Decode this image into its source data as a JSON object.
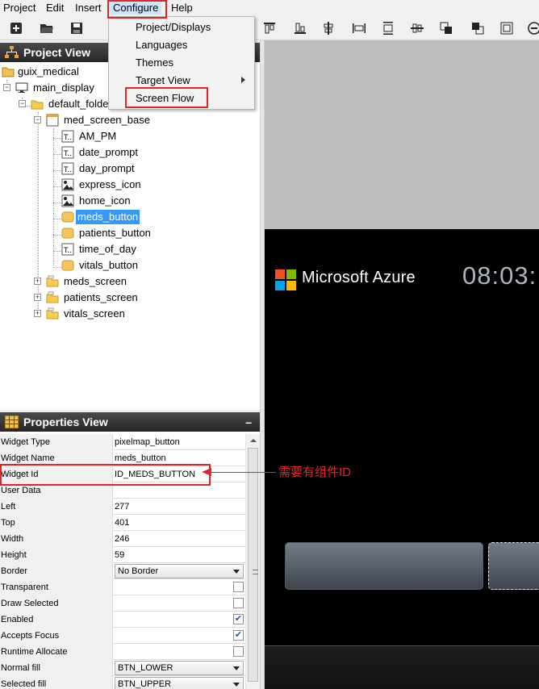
{
  "menubar": {
    "project": "Project",
    "edit": "Edit",
    "insert": "Insert",
    "configure": "Configure",
    "help": "Help"
  },
  "configure_menu": {
    "items": [
      "Project/Displays",
      "Languages",
      "Themes",
      "Target View",
      "Screen Flow"
    ],
    "submenu_item": "Target View",
    "highlighted_item": "Screen Flow"
  },
  "project_view": {
    "title": "Project View",
    "tree": [
      {
        "label": "guix_medical",
        "icon": "project-icon",
        "level": 0
      },
      {
        "label": "main_display",
        "icon": "display-icon",
        "level": 1,
        "expanded": true
      },
      {
        "label": "default_folder",
        "icon": "folder-icon",
        "level": 2,
        "expanded": true
      },
      {
        "label": "med_screen_base",
        "icon": "window-icon",
        "level": 3,
        "expanded": true
      },
      {
        "label": "AM_PM",
        "icon": "text-widget-icon",
        "level": 4
      },
      {
        "label": "date_prompt",
        "icon": "text-widget-icon",
        "level": 4
      },
      {
        "label": "day_prompt",
        "icon": "text-widget-icon",
        "level": 4
      },
      {
        "label": "express_icon",
        "icon": "icon-widget-icon",
        "level": 4
      },
      {
        "label": "home_icon",
        "icon": "icon-widget-icon",
        "level": 4
      },
      {
        "label": "meds_button",
        "icon": "button-icon",
        "level": 4,
        "selected": true
      },
      {
        "label": "patients_button",
        "icon": "button-icon",
        "level": 4
      },
      {
        "label": "time_of_day",
        "icon": "text-widget-icon",
        "level": 4
      },
      {
        "label": "vitals_button",
        "icon": "button-icon",
        "level": 4
      },
      {
        "label": "meds_screen",
        "icon": "screen-icon",
        "level": 3,
        "expanded": false
      },
      {
        "label": "patients_screen",
        "icon": "screen-icon",
        "level": 3,
        "expanded": false
      },
      {
        "label": "vitals_screen",
        "icon": "screen-icon",
        "level": 3,
        "expanded": false
      }
    ]
  },
  "properties_view": {
    "title": "Properties View",
    "rows": [
      {
        "name": "Widget Type",
        "kind": "text",
        "value": "pixelmap_button"
      },
      {
        "name": "Widget Name",
        "kind": "text",
        "value": "meds_button"
      },
      {
        "name": "Widget Id",
        "kind": "text",
        "value": "ID_MEDS_BUTTON"
      },
      {
        "name": "User Data",
        "kind": "text",
        "value": ""
      },
      {
        "name": "Left",
        "kind": "text",
        "value": "277"
      },
      {
        "name": "Top",
        "kind": "text",
        "value": "401"
      },
      {
        "name": "Width",
        "kind": "text",
        "value": "246"
      },
      {
        "name": "Height",
        "kind": "text",
        "value": "59"
      },
      {
        "name": "Border",
        "kind": "combo",
        "value": "No Border"
      },
      {
        "name": "Transparent",
        "kind": "check",
        "checked": false
      },
      {
        "name": "Draw Selected",
        "kind": "check",
        "checked": false
      },
      {
        "name": "Enabled",
        "kind": "check",
        "checked": true
      },
      {
        "name": "Accepts Focus",
        "kind": "check",
        "checked": true
      },
      {
        "name": "Runtime Allocate",
        "kind": "check",
        "checked": false
      },
      {
        "name": "Normal fill",
        "kind": "combo",
        "value": "BTN_LOWER"
      },
      {
        "name": "Selected fill",
        "kind": "combo",
        "value": "BTN_UPPER"
      }
    ]
  },
  "canvas": {
    "brand": "Microsoft Azure",
    "clock": "08:03:",
    "logo_colors": [
      "#f25022",
      "#7fba00",
      "#00a4ef",
      "#ffb900"
    ]
  },
  "annotation": {
    "text": "需要有组件ID",
    "color": "#e3242b"
  },
  "colors": {
    "selection": "#3399ff",
    "panel_header": "#333333",
    "annotation": "#e3242b"
  }
}
